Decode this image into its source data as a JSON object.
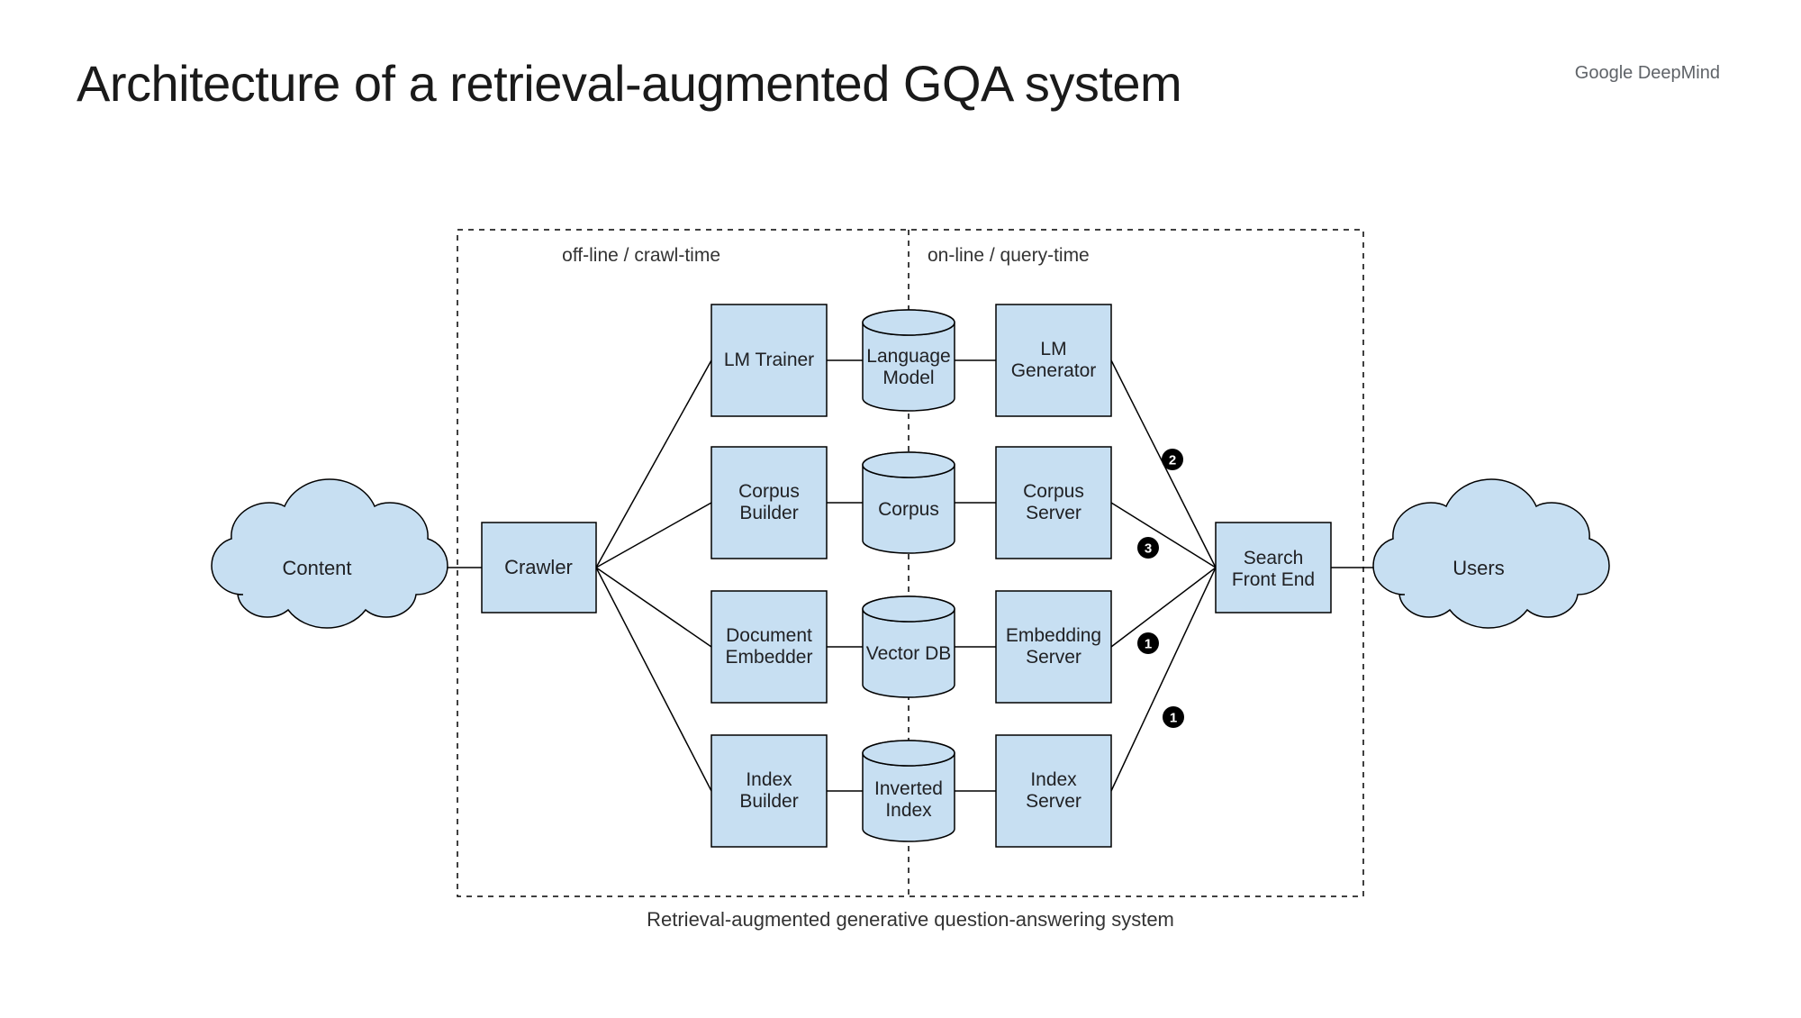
{
  "title": "Architecture of a retrieval-augmented GQA system",
  "brand": "Google DeepMind",
  "zones": {
    "offline": "off-line / crawl-time",
    "online": "on-line / query-time"
  },
  "caption": "Retrieval-augmented generative question-answering system",
  "nodes": {
    "content": "Content",
    "crawler": "Crawler",
    "lm_trainer": "LM Trainer",
    "corpus_builder_l1": "Corpus",
    "corpus_builder_l2": "Builder",
    "doc_embedder_l1": "Document",
    "doc_embedder_l2": "Embedder",
    "index_builder_l1": "Index",
    "index_builder_l2": "Builder",
    "language_model_l1": "Language",
    "language_model_l2": "Model",
    "corpus": "Corpus",
    "vector_db": "Vector DB",
    "inverted_index_l1": "Inverted",
    "inverted_index_l2": "Index",
    "lm_generator_l1": "LM",
    "lm_generator_l2": "Generator",
    "corpus_server_l1": "Corpus",
    "corpus_server_l2": "Server",
    "embedding_server_l1": "Embedding",
    "embedding_server_l2": "Server",
    "index_server_l1": "Index",
    "index_server_l2": "Server",
    "frontend_l1": "Search",
    "frontend_l2": "Front End",
    "users": "Users"
  },
  "bullets": {
    "b1a": "1",
    "b1b": "1",
    "b2": "2",
    "b3": "3"
  }
}
